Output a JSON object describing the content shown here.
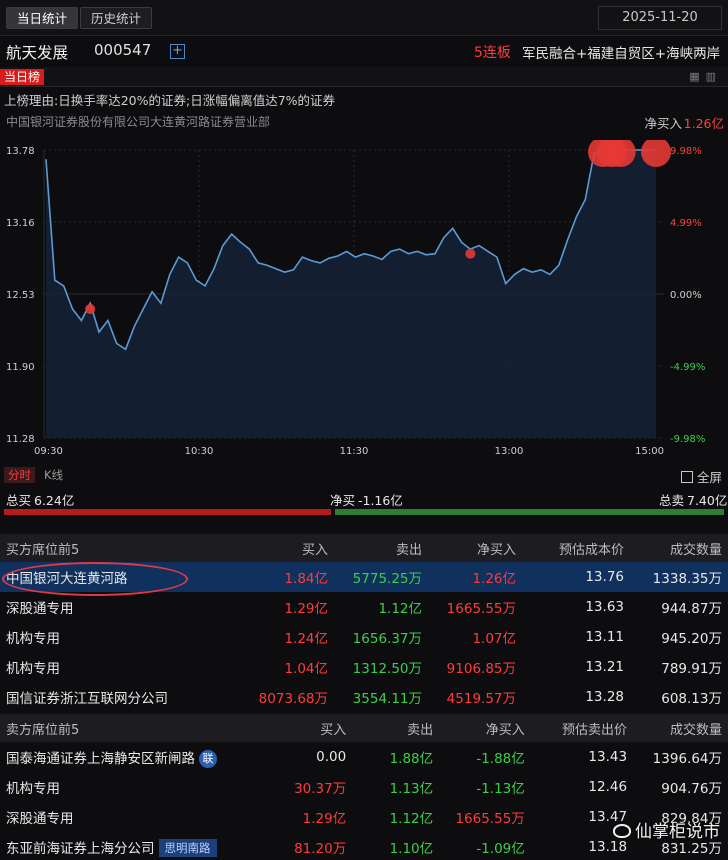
{
  "tabs": [
    {
      "label": "当日统计",
      "active": true
    },
    {
      "label": "历史统计",
      "active": false
    }
  ],
  "date": "2025-11-20",
  "stock": {
    "name": "航天发展",
    "code": "000547",
    "lianban": "5连板",
    "concepts": "军民融合+福建自贸区+海峡两岸"
  },
  "rank_tag": "当日榜",
  "reason": "上榜理由:日换手率达20%的证券;日涨幅偏离值达7%的证券",
  "seat": "中国银河证券股份有限公司大连黄河路证券营业部",
  "net_buy": {
    "label": "净买入",
    "value": "1.26亿"
  },
  "chart_data": {
    "type": "line",
    "y_left_ticks": [
      "13.78",
      "13.16",
      "12.53",
      "11.90",
      "11.28"
    ],
    "y_right_ticks": [
      "9.98%",
      "4.99%",
      "0.00%",
      "-4.99%",
      "-9.98%"
    ],
    "x_ticks": [
      "09:30",
      "10:30",
      "11:30",
      "13:00",
      "15:00"
    ],
    "ylim": [
      11.28,
      13.78
    ],
    "colors": {
      "line": "#5b9bd5",
      "fill": "#15243a",
      "marker": "#e53935"
    },
    "series": [
      {
        "values": [
          13.7,
          12.65,
          12.6,
          12.4,
          12.3,
          12.45,
          12.2,
          12.3,
          12.1,
          12.05,
          12.25,
          12.4,
          12.55,
          12.45,
          12.7,
          12.85,
          12.8,
          12.65,
          12.6,
          12.75,
          12.95,
          13.05,
          12.98,
          12.92,
          12.8,
          12.78,
          12.75,
          12.72,
          12.74,
          12.85,
          12.82,
          12.8,
          12.84,
          12.86,
          12.9,
          12.85,
          12.88,
          12.86,
          12.83,
          12.9,
          12.92,
          12.88,
          12.9,
          12.87,
          12.88,
          13.02,
          13.1,
          12.98,
          12.92,
          12.95,
          12.9,
          12.85,
          12.62,
          12.7,
          12.75,
          12.72,
          12.74,
          12.7,
          12.78,
          13.0,
          13.2,
          13.35,
          13.75,
          13.78,
          13.78,
          13.78,
          13.78,
          13.78,
          13.78,
          13.78
        ]
      }
    ],
    "markers": [
      {
        "index": 5,
        "value": 12.4,
        "size": "small"
      },
      {
        "index": 48,
        "value": 12.88,
        "size": "small"
      },
      {
        "index": 63,
        "value": 13.78,
        "size": "large"
      },
      {
        "index": 64,
        "value": 13.78,
        "size": "large"
      },
      {
        "index": 65,
        "value": 13.78,
        "size": "large"
      },
      {
        "index": 69,
        "value": 13.78,
        "size": "large"
      }
    ]
  },
  "ktabs": {
    "time": "分时",
    "kline": "K线",
    "fullscreen": "全屏"
  },
  "totals": {
    "buy_label": "总买",
    "buy": "6.24亿",
    "net_label": "净买",
    "net": "-1.16亿",
    "sell_label": "总卖",
    "sell": "7.40亿",
    "buy_ratio": 0.457
  },
  "buy_table": {
    "headers": [
      "买方席位前5",
      "买入",
      "卖出",
      "净买入",
      "预估成本价",
      "成交数量"
    ],
    "rows": [
      {
        "name": "中国银河大连黄河路",
        "buy": "1.84亿",
        "sell": "5775.25万",
        "net": "1.26亿",
        "price": "13.76",
        "volume": "1338.35万"
      },
      {
        "name": "深股通专用",
        "buy": "1.29亿",
        "sell": "1.12亿",
        "net": "1665.55万",
        "price": "13.63",
        "volume": "944.87万"
      },
      {
        "name": "机构专用",
        "buy": "1.24亿",
        "sell": "1656.37万",
        "net": "1.07亿",
        "price": "13.11",
        "volume": "945.20万"
      },
      {
        "name": "机构专用",
        "buy": "1.04亿",
        "sell": "1312.50万",
        "net": "9106.85万",
        "price": "13.21",
        "volume": "789.91万"
      },
      {
        "name": "国信证券浙江互联网分公司",
        "buy": "8073.68万",
        "sell": "3554.11万",
        "net": "4519.57万",
        "price": "13.28",
        "volume": "608.13万"
      }
    ]
  },
  "sell_table": {
    "headers": [
      "卖方席位前5",
      "买入",
      "卖出",
      "净买入",
      "预估卖出价",
      "成交数量"
    ],
    "rows": [
      {
        "name": "国泰海通证券上海静安区新闸路",
        "tag": "联",
        "buy": "0.00",
        "sell": "1.88亿",
        "net": "-1.88亿",
        "price": "13.43",
        "volume": "1396.64万"
      },
      {
        "name": "机构专用",
        "buy": "30.37万",
        "sell": "1.13亿",
        "net": "-1.13亿",
        "price": "12.46",
        "volume": "904.76万"
      },
      {
        "name": "深股通专用",
        "buy": "1.29亿",
        "sell": "1.12亿",
        "net": "1665.55万",
        "price": "13.47",
        "volume": "829.84万"
      },
      {
        "name": "东亚前海证券上海分公司",
        "tag": "思明南路",
        "buy": "81.20万",
        "sell": "1.10亿",
        "net": "-1.09亿",
        "price": "13.18",
        "volume": "831.25万"
      }
    ]
  },
  "watermark": "仙掌柜说市"
}
